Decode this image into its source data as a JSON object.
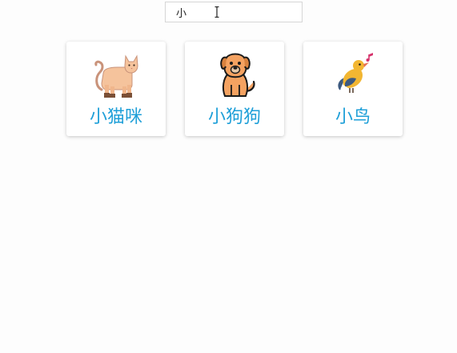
{
  "search": {
    "value": "小"
  },
  "cards": [
    {
      "label": "小猫咪",
      "icon": "cat-icon"
    },
    {
      "label": "小狗狗",
      "icon": "dog-icon"
    },
    {
      "label": "小鸟",
      "icon": "bird-icon"
    }
  ],
  "colors": {
    "label": "#1e9fd8",
    "background": "#fdfdfd",
    "card": "#ffffff"
  }
}
